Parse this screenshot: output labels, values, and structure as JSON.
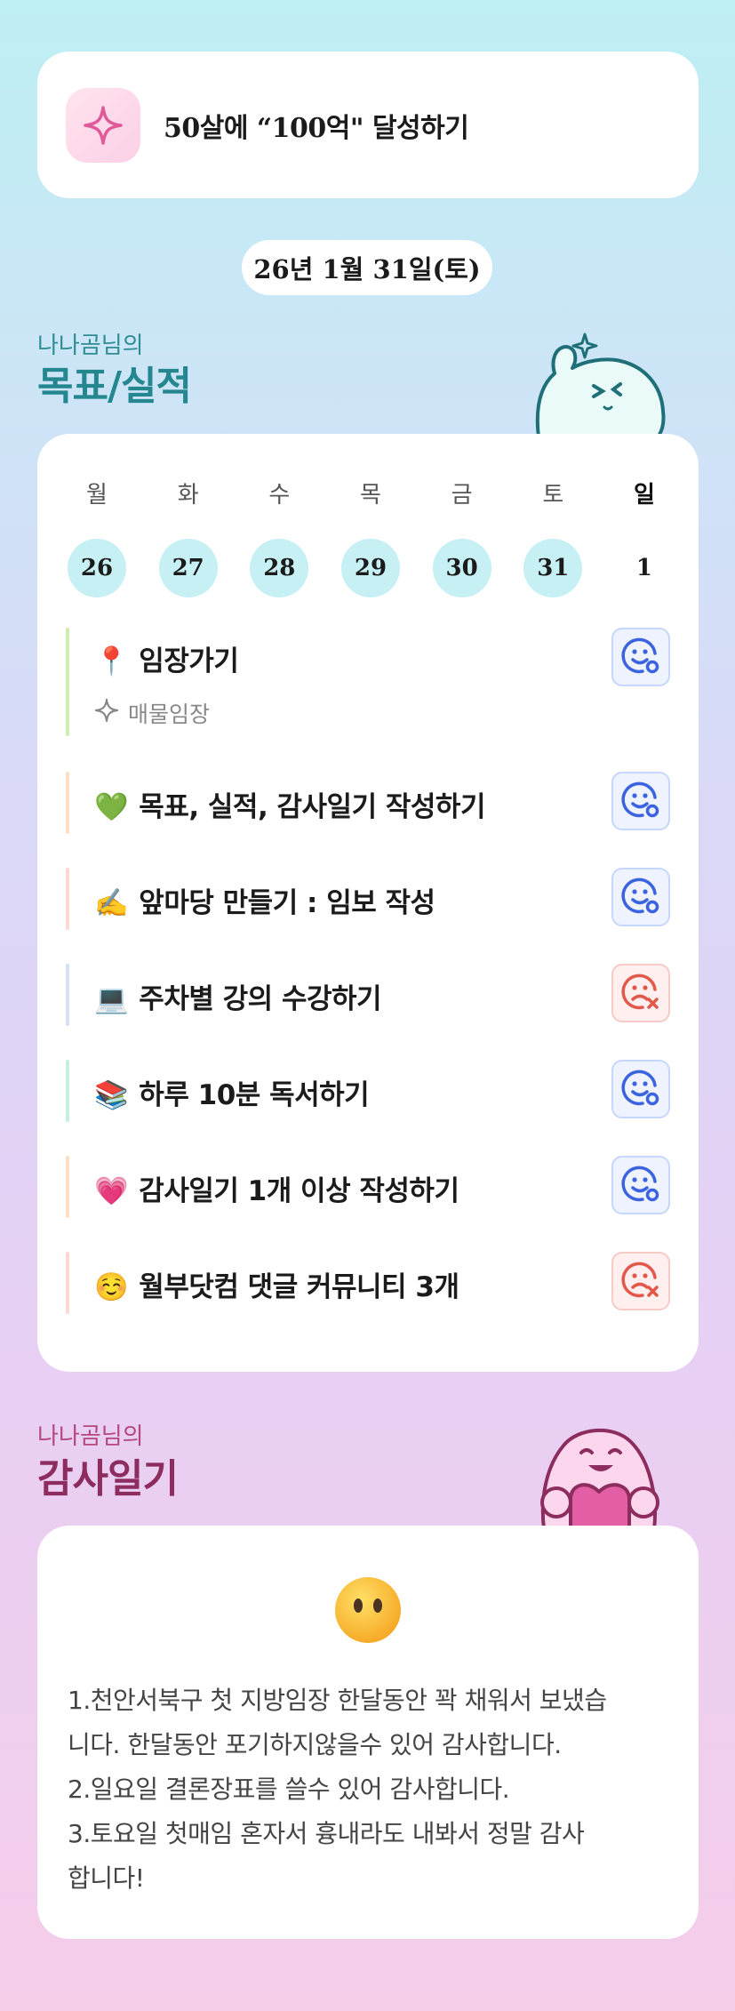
{
  "goal": {
    "text": "50살에 “100억\" 달성하기",
    "icon": "sparkle-icon"
  },
  "date": "26년 1월 31일(토)",
  "goals_section": {
    "subtitle": "나나곰님의",
    "title": "목표/실적"
  },
  "week": {
    "days": [
      "월",
      "화",
      "수",
      "목",
      "금",
      "토",
      "일"
    ],
    "dates": [
      "26",
      "27",
      "28",
      "29",
      "30",
      "31",
      "1"
    ],
    "filled": [
      true,
      true,
      true,
      true,
      true,
      true,
      false
    ]
  },
  "tasks": [
    {
      "emoji": "📍",
      "title": "임장가기",
      "sub": "매물임장",
      "status": "done",
      "bar_color": "#cdeeb0"
    },
    {
      "emoji": "💚",
      "title": "목표, 실적, 감사일기 작성하기",
      "status": "done",
      "bar_color": "#fde0c4"
    },
    {
      "emoji": "✍️",
      "title": "앞마당 만들기 : 임보 작성",
      "status": "done",
      "bar_color": "#fdd7d2"
    },
    {
      "emoji": "💻",
      "title": "주차별 강의 수강하기",
      "status": "fail",
      "bar_color": "#d3e0f7"
    },
    {
      "emoji": "📚",
      "title": "하루 10분 독서하기",
      "status": "done",
      "bar_color": "#c6f0de"
    },
    {
      "emoji": "💗",
      "title": "감사일기 1개 이상 작성하기",
      "status": "done",
      "bar_color": "#fde0c4"
    },
    {
      "emoji": "☺️",
      "title": "월부닷컴 댓글 커뮤니티 3개",
      "status": "fail",
      "bar_color": "#fdd7d2"
    }
  ],
  "diary_section": {
    "subtitle": "나나곰님의",
    "title": "감사일기"
  },
  "diary": {
    "mood_icon": "neutral-face-icon",
    "lines": [
      "1.천안서북구 첫 지방임장 한달동안 꽉 채워서 보냈습",
      "니다. 한달동안 포기하지않을수 있어 감사합니다.",
      "2.일요일 결론장표를 쓸수 있어 감사합니다.",
      "3.토요일 첫매임 혼자서 흉내라도 내봐서 정말 감사",
      "합니다!"
    ]
  },
  "colors": {
    "ok": "#3b63e0",
    "fail": "#e2584b",
    "teal": "#24878f",
    "pink": "#8d2c5e"
  }
}
